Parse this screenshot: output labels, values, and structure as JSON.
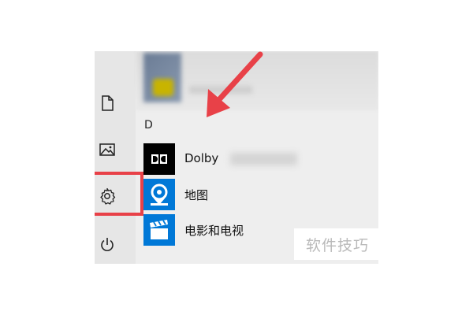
{
  "colors": {
    "highlight": "#e84148",
    "tile_blue": "#0078d7",
    "dolby_black": "#000000",
    "panel_bg": "#eeeeee"
  },
  "left_rail": {
    "items": [
      {
        "icon": "document-icon"
      },
      {
        "icon": "pictures-icon"
      },
      {
        "icon": "settings-gear-icon"
      },
      {
        "icon": "power-icon"
      }
    ]
  },
  "app_list": {
    "section_letter": "D",
    "apps": [
      {
        "name": "Dolby",
        "icon": "dolby-icon"
      },
      {
        "name": "地图",
        "icon": "maps-icon"
      },
      {
        "name": "电影和电视",
        "icon": "movies-tv-icon"
      }
    ]
  },
  "watermark": {
    "text": "软件技巧"
  }
}
